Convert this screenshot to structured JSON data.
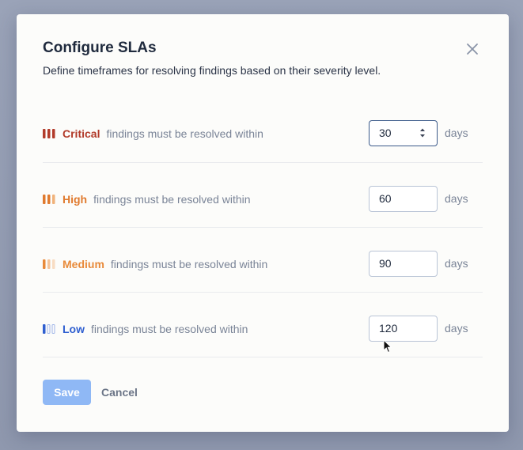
{
  "dialog": {
    "title": "Configure SLAs",
    "description": "Define timeframes for resolving findings based on their severity level."
  },
  "rows": [
    {
      "severity": "Critical",
      "text": "findings must be resolved within",
      "value": "30",
      "unit": "days",
      "color": "#b23b2a"
    },
    {
      "severity": "High",
      "text": "findings must be resolved within",
      "value": "60",
      "unit": "days",
      "color": "#e07a2e"
    },
    {
      "severity": "Medium",
      "text": "findings must be resolved within",
      "value": "90",
      "unit": "days",
      "color": "#e88a3a"
    },
    {
      "severity": "Low",
      "text": "findings must be resolved within",
      "value": "120",
      "unit": "days",
      "color": "#2f5fd0"
    }
  ],
  "footer": {
    "save_label": "Save",
    "cancel_label": "Cancel"
  },
  "icons": {
    "close": "close-icon",
    "severity": "severity-bars-icon",
    "spinner": "spinner-icon",
    "cursor": "mouse-pointer-icon"
  }
}
